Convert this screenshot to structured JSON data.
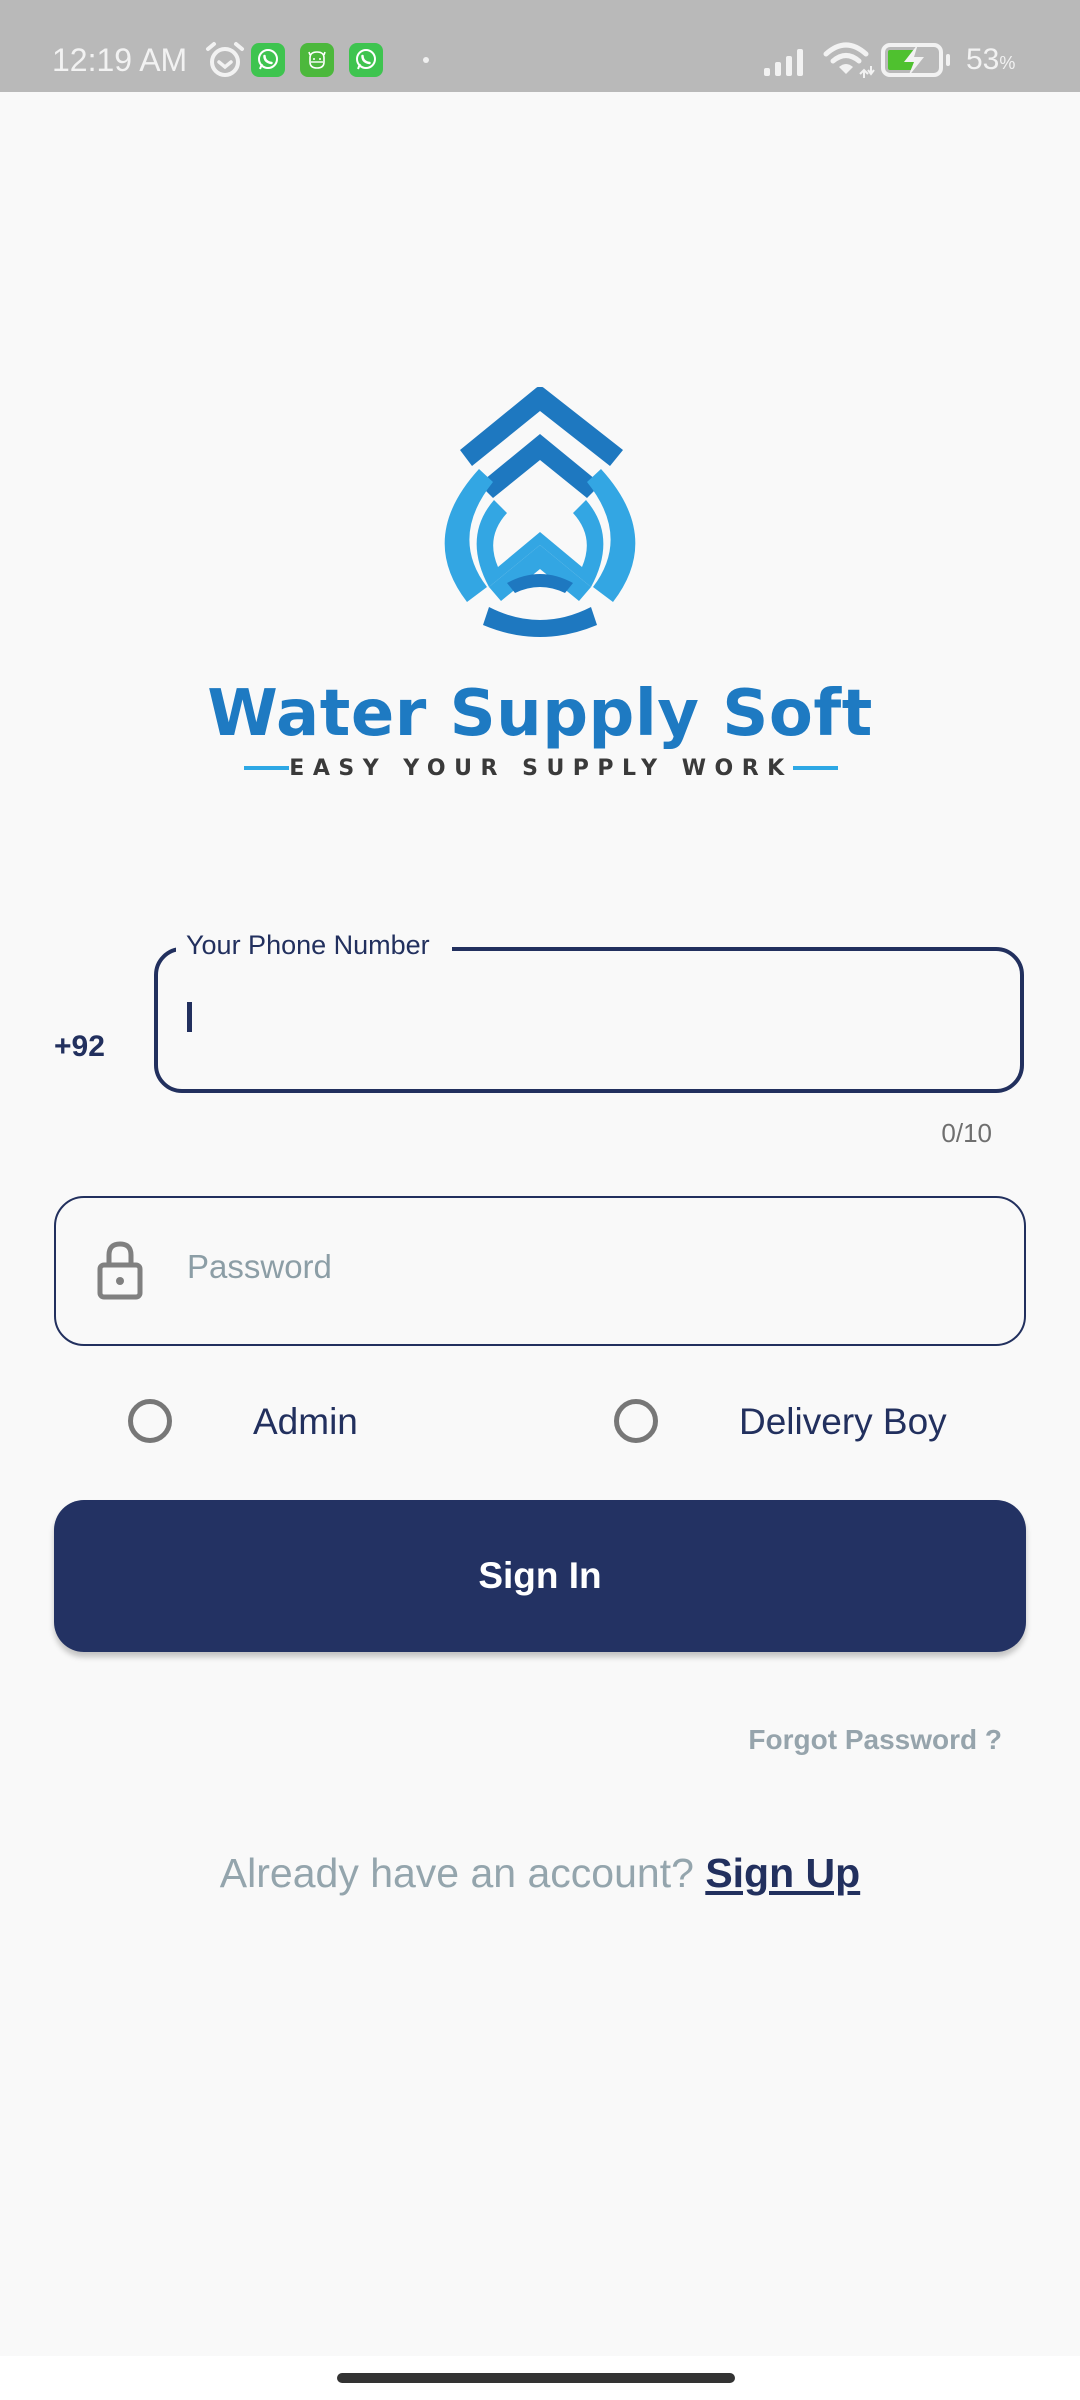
{
  "status_bar": {
    "time": "12:19 AM",
    "icons": [
      "alarm-icon",
      "whatsapp-icon",
      "app-notification-icon",
      "whatsapp-icon",
      "more-notifications-dot",
      "signal-icon",
      "wifi-icon",
      "battery-charging-icon"
    ],
    "battery_percent": "53",
    "battery_percent_sign": "%"
  },
  "branding": {
    "title": "Water Supply Soft",
    "tagline": "EASY YOUR SUPPLY WORK",
    "colors": {
      "primary_blue": "#1e7ac2",
      "light_blue": "#2ea8e5"
    }
  },
  "form": {
    "country_code": "+92",
    "phone": {
      "label": "Your Phone Number",
      "value": "",
      "counter": "0/10"
    },
    "password": {
      "placeholder": "Password",
      "value": "",
      "icon": "lock-icon"
    },
    "roles": [
      {
        "label": "Admin",
        "selected": false
      },
      {
        "label": "Delivery Boy",
        "selected": false
      }
    ],
    "sign_in_label": "Sign In",
    "forgot_password_label": "Forgot Password ?",
    "account_prompt": "Already have an account?",
    "sign_up_label": "Sign Up"
  },
  "theme": {
    "navy": "#233263",
    "muted_text": "#94a5ad",
    "background": "#f9f9f9"
  }
}
